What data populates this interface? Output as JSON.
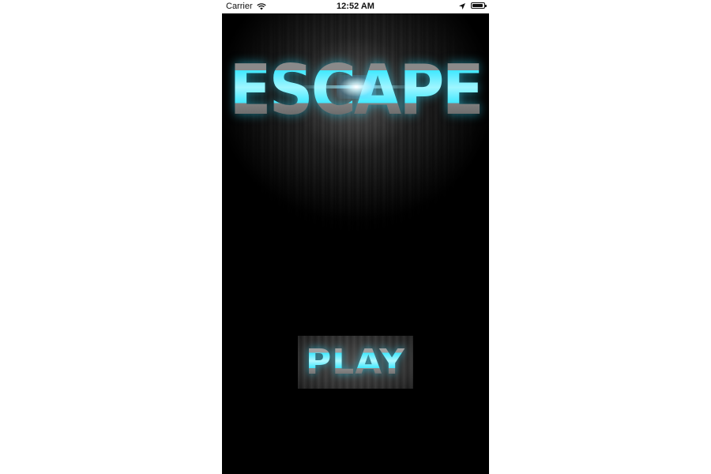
{
  "status_bar": {
    "carrier": "Carrier",
    "wifi_icon": "wifi-icon",
    "time": "12:52 AM",
    "location_icon": "location-arrow-icon",
    "battery_icon": "battery-icon"
  },
  "game": {
    "title": "ESCAPE",
    "play_label": "PLAY",
    "accent_color": "#3fe8ff",
    "background_color": "#000000"
  }
}
